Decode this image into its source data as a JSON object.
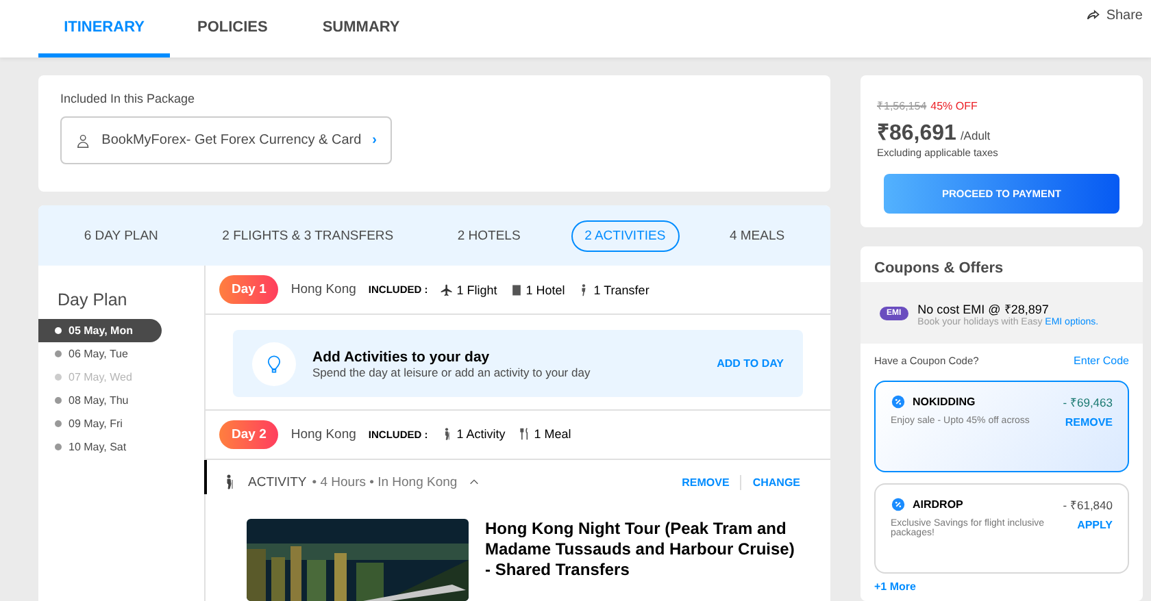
{
  "nav": {
    "tabs": [
      {
        "label": "ITINERARY",
        "selected": true
      },
      {
        "label": "POLICIES",
        "selected": false
      },
      {
        "label": "SUMMARY",
        "selected": false
      }
    ],
    "share": "Share"
  },
  "package": {
    "title": "Included In this Package",
    "forex": "BookMyForex- Get Forex Currency & Card",
    "chevron": "›"
  },
  "summary_tabs": [
    {
      "label": "6 DAY PLAN",
      "selected": false
    },
    {
      "label": "2 FLIGHTS & 3 TRANSFERS",
      "selected": false
    },
    {
      "label": "2 HOTELS",
      "selected": false
    },
    {
      "label": "2 ACTIVITIES",
      "selected": true
    },
    {
      "label": "4 MEALS",
      "selected": false
    }
  ],
  "day_plan": {
    "title": "Day Plan",
    "days": [
      {
        "label": "05 May, Mon",
        "selected": true,
        "disabled": false
      },
      {
        "label": "06 May, Tue",
        "selected": false,
        "disabled": false
      },
      {
        "label": "07 May, Wed",
        "selected": false,
        "disabled": true
      },
      {
        "label": "08 May, Thu",
        "selected": false,
        "disabled": false
      },
      {
        "label": "09 May, Fri",
        "selected": false,
        "disabled": false
      },
      {
        "label": "10 May, Sat",
        "selected": false,
        "disabled": false
      }
    ]
  },
  "days": [
    {
      "badge": "Day 1",
      "city": "Hong Kong",
      "included_label": "INCLUDED :",
      "items": [
        {
          "kind": "flight",
          "label": "1 Flight"
        },
        {
          "kind": "hotel",
          "label": "1 Hotel"
        },
        {
          "kind": "transfer",
          "label": "1 Transfer"
        }
      ],
      "add_card": {
        "title": "Add Activities to your day",
        "subtitle": "Spend the day at leisure or add an activity to your day",
        "action": "ADD TO DAY"
      }
    },
    {
      "badge": "Day 2",
      "city": "Hong Kong",
      "included_label": "INCLUDED :",
      "items": [
        {
          "kind": "activity",
          "label": "1 Activity"
        },
        {
          "kind": "meal",
          "label": "1 Meal"
        }
      ],
      "activity": {
        "type": "ACTIVITY",
        "details": "• 4 Hours • In Hong Kong",
        "remove": "REMOVE",
        "change": "CHANGE",
        "name": "Hong Kong Night Tour (Peak Tram and Madame Tussauds and Harbour Cruise) - Shared Transfers"
      }
    }
  ],
  "price": {
    "original": "₹1,56,154",
    "discount": "45% OFF",
    "amount": "₹86,691",
    "per": "/Adult",
    "note": "Excluding applicable taxes",
    "button": "PROCEED TO PAYMENT"
  },
  "coupons": {
    "title": "Coupons & Offers",
    "emi_badge": "EMI",
    "emi_title": "No cost EMI @ ₹28,897",
    "emi_text": "Book your holidays with Easy",
    "emi_link": "EMI options.",
    "code_prompt": "Have a Coupon Code?",
    "enter_code": "Enter Code",
    "offers": [
      {
        "code": "NOKIDDING",
        "amount": "- ₹69,463",
        "text": "Enjoy sale - Upto 45% off across",
        "action": "REMOVE",
        "selected": true
      },
      {
        "code": "AIRDROP",
        "amount": "- ₹61,840",
        "text": "Exclusive Savings for flight inclusive packages!",
        "action": "APPLY",
        "selected": false
      }
    ],
    "more": "+1 More"
  }
}
